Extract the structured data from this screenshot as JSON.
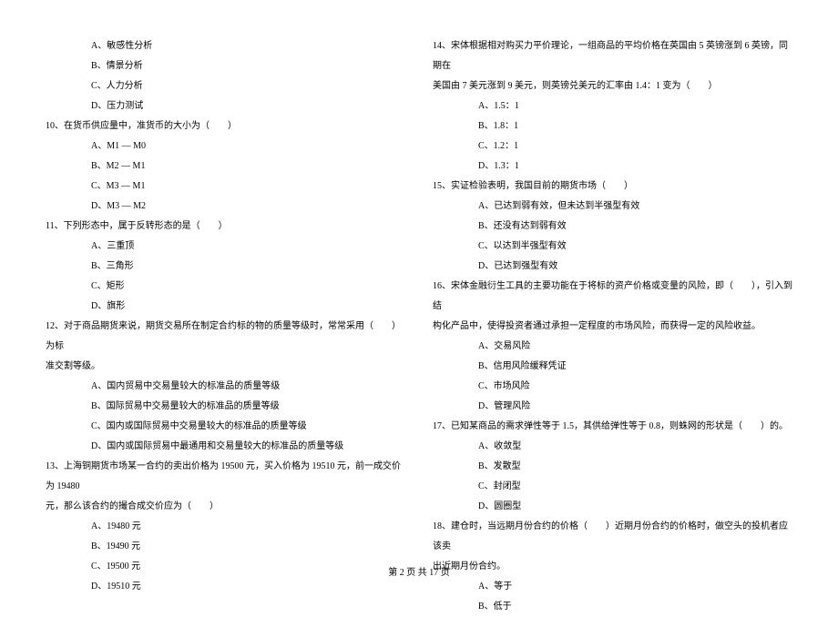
{
  "left_column": {
    "options_q9": [
      "A、敏感性分析",
      "B、情景分析",
      "C、人力分析",
      "D、压力测试"
    ],
    "q10": {
      "stem": "10、在货币供应量中，准货币的大小为（　　）",
      "options": [
        "A、M1 — M0",
        "B、M2 — M1",
        "C、M3 — M1",
        "D、M3 — M2"
      ]
    },
    "q11": {
      "stem": "11、下列形态中，属于反转形态的是（　　）",
      "options": [
        "A、三重顶",
        "B、三角形",
        "C、矩形",
        "D、旗形"
      ]
    },
    "q12": {
      "stem": "12、对于商品期货来说，期货交易所在制定合约标的物的质量等级时，常常采用（　　）为标",
      "stem_cont": "准交割等级。",
      "options": [
        "A、国内贸易中交易量较大的标准品的质量等级",
        "B、国际贸易中交易量较大的标准品的质量等级",
        "C、国内或国际贸易中交易量较大的标准品的质量等级",
        "D、国内或国际贸易中最通用和交易量较大的标准品的质量等级"
      ]
    },
    "q13": {
      "stem": "13、上海铜期货市场某一合约的卖出价格为 19500 元，买入价格为 19510 元，前一成交价为 19480",
      "stem_cont": "元，那么该合约的撮合成交价应为（　　）",
      "options": [
        "A、19480 元",
        "B、19490 元",
        "C、19500 元",
        "D、19510 元"
      ]
    }
  },
  "right_column": {
    "q14": {
      "stem": "14、宋体根据相对购买力平价理论，一组商品的平均价格在英国由 5 英镑涨到 6 英镑，同期在",
      "stem_cont": "美国由 7 美元涨到 9 美元，则英镑兑美元的汇率由 1.4：1 变为（　　）",
      "options": [
        "A、1.5：1",
        "B、1.8：1",
        "C、1.2：1",
        "D、1.3：1"
      ]
    },
    "q15": {
      "stem": "15、实证检验表明，我国目前的期货市场（　　）",
      "options": [
        "A、已达到弱有效，但未达到半强型有效",
        "B、还没有达到弱有效",
        "C、以达到半强型有效",
        "D、已达到强型有效"
      ]
    },
    "q16": {
      "stem": "16、宋体金融衍生工具的主要功能在于将标的资产价格或变量的风险，即（　　），引入到结",
      "stem_cont": "构化产品中，使得投资者通过承担一定程度的市场风险，而获得一定的风险收益。",
      "options": [
        "A、交易风险",
        "B、信用风险缓释凭证",
        "C、市场风险",
        "D、管理风险"
      ]
    },
    "q17": {
      "stem": "17、已知某商品的需求弹性等于 1.5，其供给弹性等于 0.8，则蛛网的形状是（　　）的。",
      "options": [
        "A、收敛型",
        "B、发散型",
        "C、封闭型",
        "D、圆圈型"
      ]
    },
    "q18": {
      "stem": "18、建仓时，当远期月份合约的价格（　　）近期月份合约的价格时，做空头的投机者应该卖",
      "stem_cont": "出近期月份合约。",
      "options": [
        "A、等于",
        "B、低于"
      ]
    }
  },
  "footer": "第 2 页 共 17 页"
}
